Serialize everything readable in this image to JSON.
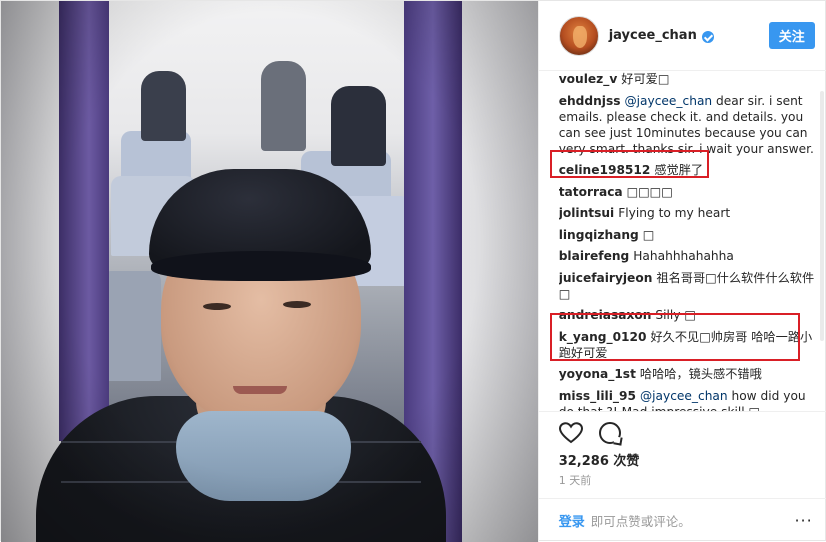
{
  "post": {
    "username": "jaycee_chan",
    "follow_label": "关注",
    "likes": "32,286 次赞",
    "time": "1 天前"
  },
  "comments": [
    {
      "user": "voulez_v",
      "text": "好可爱□"
    },
    {
      "user": "ehddnjss",
      "mention": "@jaycee_chan",
      "text": " dear sir. i sent emails. please check it. and details. you can see just 10minutes because you can very smart. thanks sir. i wait your answer."
    },
    {
      "user": "celine198512",
      "text": "感觉胖了"
    },
    {
      "user": "tatorraca",
      "text": "□□□□"
    },
    {
      "user": "jolintsui",
      "text": "Flying to my heart"
    },
    {
      "user": "lingqizhang",
      "text": "□"
    },
    {
      "user": "blairefeng",
      "text": "Hahahhhahahha"
    },
    {
      "user": "juicefairyjeon",
      "text": "祖名哥哥□什么软件什么软件□"
    },
    {
      "user": "andreiasaxon",
      "text": "Silly □"
    },
    {
      "user": "k_yang_0120",
      "text": "好久不见□帅房哥 哈哈一路小跑好可爱"
    },
    {
      "user": "yoyona_1st",
      "text": "哈哈哈，镜头感不错哦"
    },
    {
      "user": "miss_lili_95",
      "mention": "@jaycee_chan",
      "text": " how did you do that ?! Mad impressive skill □"
    }
  ],
  "footer": {
    "login_label": "登录",
    "comment_placeholder": "即可点赞或评论。",
    "more_label": "···"
  }
}
